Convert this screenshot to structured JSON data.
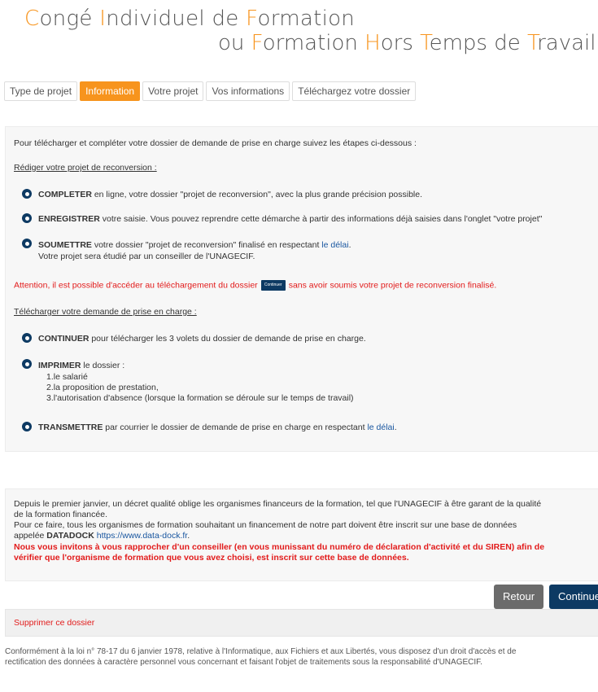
{
  "header": {
    "line1": [
      {
        "cap": "C",
        "rest": "ongé "
      },
      {
        "cap": "I",
        "rest": "ndividuel de "
      },
      {
        "cap": "F",
        "rest": "ormation"
      }
    ],
    "line2": [
      {
        "cap": "",
        "rest": "ou "
      },
      {
        "cap": "F",
        "rest": "ormation "
      },
      {
        "cap": "H",
        "rest": "ors "
      },
      {
        "cap": "T",
        "rest": "emps de "
      },
      {
        "cap": "T",
        "rest": "ravail"
      }
    ]
  },
  "tabs": [
    {
      "label": "Type de projet",
      "active": false
    },
    {
      "label": "Information",
      "active": true
    },
    {
      "label": "Votre projet",
      "active": false
    },
    {
      "label": "Vos informations",
      "active": false
    },
    {
      "label": "Téléchargez votre dossier",
      "active": false
    }
  ],
  "info": {
    "intro": "Pour télécharger et compléter votre dossier de demande de prise en charge suivez les étapes ci-dessous :",
    "section1": "Rédiger votre projet de reconversion :",
    "s1_b1_strong": "COMPLETER",
    "s1_b1_text": " en ligne, votre dossier \"projet de reconversion\", avec la plus grande précision possible.",
    "s1_b2_strong": "ENREGISTRER",
    "s1_b2_text": " votre saisie. Vous pouvez reprendre cette démarche à partir des informations déjà saisies dans l'onglet \"votre projet\"",
    "s1_b3_strong": "SOUMETTRE",
    "s1_b3_text": " votre dossier \"projet de reconversion\" finalisé en respectant ",
    "s1_b3_link": "le délai",
    "s1_b3_end": ".",
    "s1_b3_sub": "Votre projet sera étudié par un conseiller de l'UNAGECIF.",
    "warning_a": "Attention, il est possible d'accéder au téléchargement du dossier",
    "warning_btn": "Continuer",
    "warning_b": "sans avoir soumis votre projet de reconversion finalisé.",
    "section2": "Télécharger votre demande de prise en charge :",
    "s2_b1_strong": "CONTINUER",
    "s2_b1_text": " pour télécharger les 3 volets du dossier de demande de prise en charge.",
    "s2_b2_strong": "IMPRIMER",
    "s2_b2_text": " le dossier :",
    "s2_b2_items": [
      "1.le salarié",
      "2.la proposition de prestation,",
      "3.l'autorisation d'absence (lorsque la formation se déroule sur le temps de travail)"
    ],
    "s2_b3_strong": "TRANSMETTRE",
    "s2_b3_text": " par courrier le dossier de demande de prise en charge en respectant ",
    "s2_b3_link": "le délai",
    "s2_b3_end": "."
  },
  "datadock": {
    "p1": "Depuis le premier janvier, un décret qualité oblige les organismes financeurs de la formation, tel que l'UNAGECIF à être garant de la qualité",
    "p1b": "de la formation financée.",
    "p2": "Pour ce faire, tous les organismes de formation souhaitant un financement de notre part doivent être inscrit sur une base de données",
    "p3_a": "appelée ",
    "p3_strong": "DATADOCK",
    "p3_link": " https://www.data-dock.fr",
    "p3_end": ".",
    "p4": "Nous vous invitons à vous rapprocher d'un conseiller (en vous munissant du numéro de déclaration d'activité et du SIREN) afin de",
    "p5": "vérifier que l'organisme de formation que vous avez choisi, est inscrit sur cette base de données."
  },
  "buttons": {
    "retour": "Retour",
    "continuer": "Continuer"
  },
  "delete": "Supprimer ce dossier",
  "footer": {
    "l1": "Conformément à la loi n° 78-17 du 6 janvier 1978, relative à l'Informatique, aux Fichiers et aux Libertés, vous disposez d'un droit d'accès et de",
    "l2": "rectification des données à caractère personnel vous concernant et faisant l'objet de traitements sous la responsabilité d'UNAGECIF."
  },
  "colors": {
    "accent": "#f7941d",
    "navy": "#0d3a63",
    "warning": "#e21b1b",
    "link": "#1a57a0"
  }
}
